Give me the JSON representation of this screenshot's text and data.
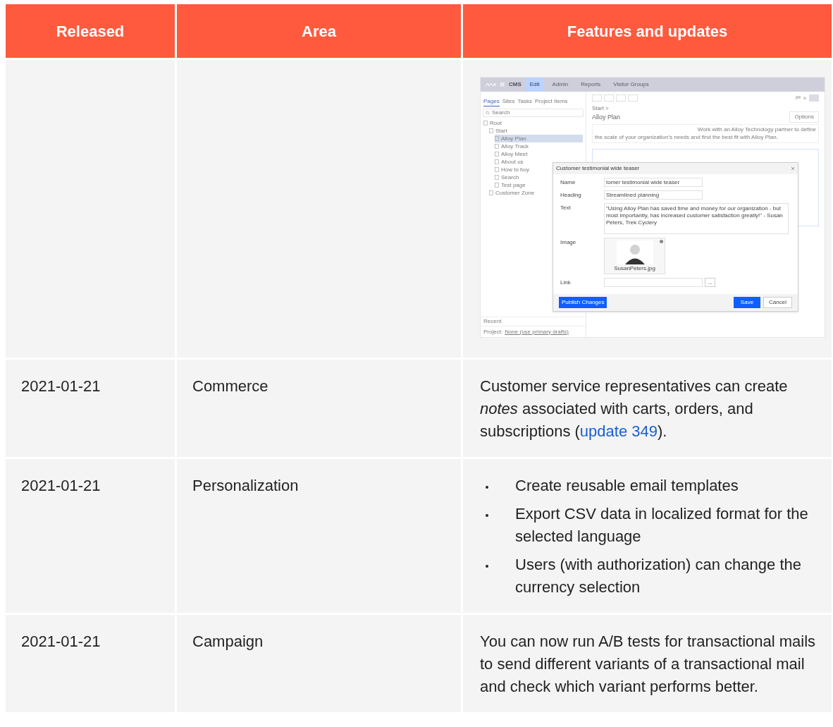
{
  "table": {
    "columns": [
      "Released",
      "Area",
      "Features and updates"
    ],
    "rows": [
      {
        "kind": "screenshot",
        "screenshot": {
          "nav": {
            "product": "CMS",
            "tabs": [
              {
                "label": "Edit",
                "selected": true
              },
              {
                "label": "Admin",
                "selected": false
              },
              {
                "label": "Reports",
                "selected": false
              },
              {
                "label": "Visitor Groups",
                "selected": false
              }
            ]
          },
          "panel_tabs": [
            {
              "label": "Pages",
              "selected": true
            },
            {
              "label": "Sites",
              "selected": false
            },
            {
              "label": "Tasks",
              "selected": false
            },
            {
              "label": "Project Items",
              "selected": false
            }
          ],
          "search": {
            "placeholder": "Search"
          },
          "tree": [
            {
              "label": "Root",
              "selected": false,
              "children": [
                {
                  "label": "Start",
                  "selected": false,
                  "children": [
                    {
                      "label": "Alloy Plan",
                      "selected": true
                    },
                    {
                      "label": "Alloy Track",
                      "selected": false
                    },
                    {
                      "label": "Alloy Meet",
                      "selected": false
                    },
                    {
                      "label": "About us",
                      "selected": false
                    },
                    {
                      "label": "How to buy",
                      "selected": false
                    },
                    {
                      "label": "Search",
                      "selected": false
                    },
                    {
                      "label": "Test page",
                      "selected": false
                    }
                  ]
                },
                {
                  "label": "Customer Zone",
                  "selected": false
                }
              ]
            }
          ],
          "recent": "Recent",
          "project_label": "Project:",
          "project_value": "None (use primary drafts)",
          "breadcrumb": "Start >",
          "page_title": "Alloy Plan",
          "options": "Options",
          "content_lines": [
            "Work with an Alloy Technology partner to define",
            "the scale of your organization's needs and find the best fit with Alloy Plan."
          ],
          "dialog": {
            "title": "Customer testimonial wide teaser",
            "fields": [
              {
                "kind": "input",
                "label": "Name",
                "value": "tomer testimonial wide teaser"
              },
              {
                "kind": "input",
                "label": "Heading",
                "value": "Streamlined planning"
              },
              {
                "kind": "textarea",
                "label": "Text",
                "value": "\"Using Alloy Plan has saved time and money for our organization - but most importantly, has increased customer satisfaction greatly!\" - Susan Peters, Trek Cyclery"
              },
              {
                "kind": "image",
                "label": "Image",
                "value": "SusanPeters.jpg"
              },
              {
                "kind": "link",
                "label": "Link",
                "button": "..."
              }
            ],
            "publish": "Publish Changes",
            "save": "Save",
            "cancel": "Cancel"
          }
        }
      },
      {
        "kind": "text",
        "released": "2021-01-21",
        "area": "Commerce",
        "before": "Customer service representatives can create *notes* associated with carts, orders, and subscriptions (",
        "link": "update 349",
        "after": ")."
      },
      {
        "kind": "list",
        "released": "2021-01-21",
        "area": "Personalization",
        "items": [
          "Create reusable email templates",
          "Export CSV data in localized format for the selected language",
          "Users (with authorization) can change the currency selection"
        ]
      },
      {
        "kind": "plain",
        "released": "2021-01-21",
        "area": "Campaign",
        "text": "You can now run A/B tests for transactional mails to send different variants of a transactional mail and check which variant performs better."
      }
    ]
  }
}
